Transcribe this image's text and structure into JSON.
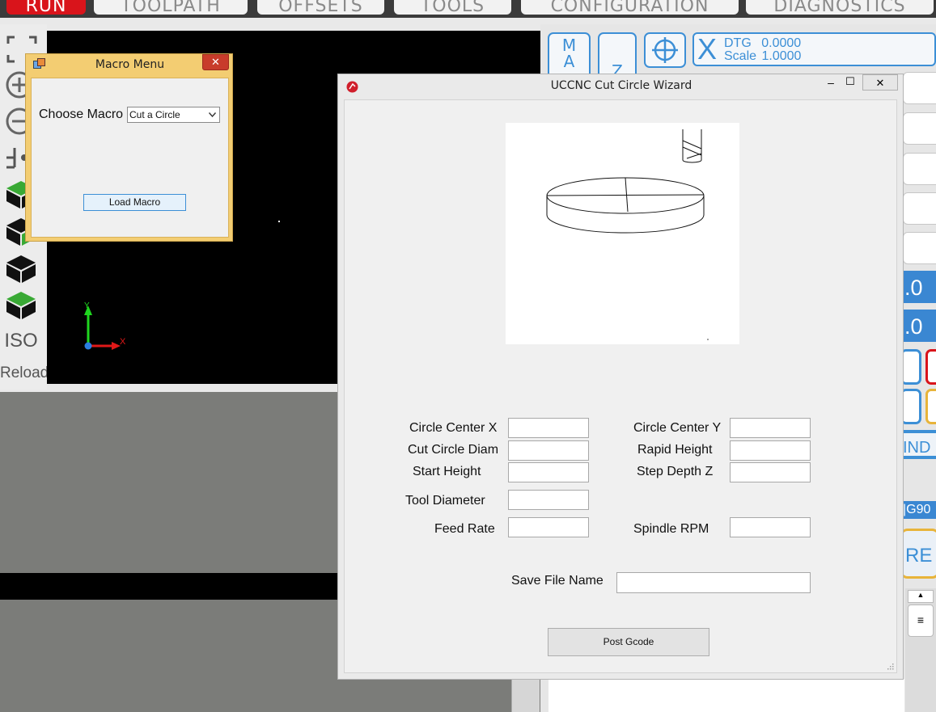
{
  "tabs": [
    "RUN",
    "TOOLPATH",
    "OFFSETS",
    "TOOLS",
    "CONFIGURATION",
    "DIAGNOSTICS"
  ],
  "left_toolbar": {
    "iso_label": "ISO",
    "reload_label": "Reload"
  },
  "axis": {
    "x_label": "X",
    "y_label": "Y"
  },
  "right_panel": {
    "mag_label": "M\nA",
    "z_label": "Z",
    "axis_letter": "X",
    "dtg_label": "DTG",
    "dtg_value": "0.0000",
    "scale_label": "Scale",
    "scale_value": "1.0000",
    "dro_partial_1": ".0",
    "dro_partial_2": ".0",
    "ind_label": "IND",
    "gcode_partial": "|G90",
    "btn_partial": "RE"
  },
  "macro_menu": {
    "title": "Macro Menu",
    "close": "✕",
    "choose_label": "Choose Macro",
    "selected": "Cut a Circle",
    "load_button": "Load Macro"
  },
  "wizard": {
    "title": "UCCNC Cut Circle Wizard",
    "minimize": "–",
    "maximize": "☐",
    "close": "✕",
    "fields": {
      "center_x": "Circle Center X",
      "center_y": "Circle Center Y",
      "cut_diam": "Cut Circle Diam",
      "rapid_height": "Rapid Height",
      "start_height": "Start Height",
      "step_depth": "Step Depth Z",
      "tool_diameter": "Tool Diameter",
      "feed_rate": "Feed Rate",
      "spindle_rpm": "Spindle RPM",
      "save_file": "Save File Name"
    },
    "post_button": "Post Gcode"
  },
  "colors": {
    "run_red": "#d9141b",
    "accent_blue": "#3c8fd6",
    "macro_frame": "#f3cd72",
    "cube_green": "#39a935"
  }
}
